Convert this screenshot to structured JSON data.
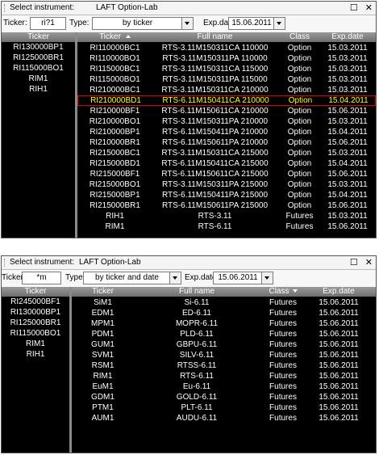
{
  "panel1": {
    "title_label": "Select instrument:",
    "app_name": "LAFT Option-Lab",
    "ticker_label": "Ticker:",
    "ticker_value": "ri?1",
    "type_label": "Type:",
    "type_value": "by ticker",
    "exp_label": "Exp.date:",
    "exp_value": "15.06.2011",
    "left_header": "Ticker",
    "left_items": [
      "RI130000BP1",
      "RI125000BR1",
      "RI115000BO1",
      "RIM1",
      "RIH1"
    ],
    "columns": [
      "Ticker",
      "Full name",
      "Class",
      "Exp.date"
    ],
    "rows": [
      {
        "ticker": "RI110000BC1",
        "full": "RTS-3.11M150311CA 110000",
        "cls": "Option",
        "exp": "15.03.2011"
      },
      {
        "ticker": "RI110000BO1",
        "full": "RTS-3.11M150311PA 110000",
        "cls": "Option",
        "exp": "15.03.2011"
      },
      {
        "ticker": "RI115000BC1",
        "full": "RTS-3.11M150311CA 115000",
        "cls": "Option",
        "exp": "15.03.2011"
      },
      {
        "ticker": "RI115000BO1",
        "full": "RTS-3.11M150311PA 115000",
        "cls": "Option",
        "exp": "15.03.2011"
      },
      {
        "ticker": "RI210000BC1",
        "full": "RTS-3.11M150311CA 210000",
        "cls": "Option",
        "exp": "15.03.2011"
      },
      {
        "ticker": "RI210000BD1",
        "full": "RTS-6.11M150411CA 210000",
        "cls": "Option",
        "exp": "15.04.2011",
        "selected": true
      },
      {
        "ticker": "RI210000BF1",
        "full": "RTS-6.11M150611CA 210000",
        "cls": "Option",
        "exp": "15.06.2011"
      },
      {
        "ticker": "RI210000BO1",
        "full": "RTS-3.11M150311PA 210000",
        "cls": "Option",
        "exp": "15.03.2011"
      },
      {
        "ticker": "RI210000BP1",
        "full": "RTS-6.11M150411PA 210000",
        "cls": "Option",
        "exp": "15.04.2011"
      },
      {
        "ticker": "RI210000BR1",
        "full": "RTS-6.11M150611PA 210000",
        "cls": "Option",
        "exp": "15.06.2011"
      },
      {
        "ticker": "RI215000BC1",
        "full": "RTS-3.11M150311CA 215000",
        "cls": "Option",
        "exp": "15.03.2011"
      },
      {
        "ticker": "RI215000BD1",
        "full": "RTS-6.11M150411CA 215000",
        "cls": "Option",
        "exp": "15.04.2011"
      },
      {
        "ticker": "RI215000BF1",
        "full": "RTS-6.11M150611CA 215000",
        "cls": "Option",
        "exp": "15.06.2011"
      },
      {
        "ticker": "RI215000BO1",
        "full": "RTS-3.11M150311PA 215000",
        "cls": "Option",
        "exp": "15.03.2011"
      },
      {
        "ticker": "RI215000BP1",
        "full": "RTS-6.11M150411PA 215000",
        "cls": "Option",
        "exp": "15.04.2011"
      },
      {
        "ticker": "RI215000BR1",
        "full": "RTS-6.11M150611PA 215000",
        "cls": "Option",
        "exp": "15.06.2011"
      },
      {
        "ticker": "RIH1",
        "full": "RTS-3.11",
        "cls": "Futures",
        "exp": "15.03.2011"
      },
      {
        "ticker": "RIM1",
        "full": "RTS-6.11",
        "cls": "Futures",
        "exp": "15.06.2011"
      }
    ]
  },
  "panel2": {
    "title_label": "Select instrument:",
    "app_name": "LAFT Option-Lab",
    "ticker_label": "Ticker:",
    "ticker_value": "*m",
    "type_label": "Type:",
    "type_value": "by ticker and date",
    "exp_label": "Exp.date:",
    "exp_value": "15.06.2011",
    "left_header": "Ticker",
    "left_items": [
      "RI245000BF1",
      "RI130000BP1",
      "RI125000BR1",
      "RI115000BO1",
      "RIM1",
      "RIH1"
    ],
    "columns": [
      "Ticker",
      "Full name",
      "Class",
      "Exp.date"
    ],
    "rows": [
      {
        "ticker": "SiM1",
        "full": "Si-6.11",
        "cls": "Futures",
        "exp": "15.06.2011"
      },
      {
        "ticker": "EDM1",
        "full": "ED-6.11",
        "cls": "Futures",
        "exp": "15.06.2011"
      },
      {
        "ticker": "MPM1",
        "full": "MOPR-6.11",
        "cls": "Futures",
        "exp": "15.06.2011"
      },
      {
        "ticker": "PDM1",
        "full": "PLD-6.11",
        "cls": "Futures",
        "exp": "15.06.2011"
      },
      {
        "ticker": "GUM1",
        "full": "GBPU-6.11",
        "cls": "Futures",
        "exp": "15.06.2011"
      },
      {
        "ticker": "SVM1",
        "full": "SILV-6.11",
        "cls": "Futures",
        "exp": "15.06.2011"
      },
      {
        "ticker": "RSM1",
        "full": "RTSS-6.11",
        "cls": "Futures",
        "exp": "15.06.2011"
      },
      {
        "ticker": "RIM1",
        "full": "RTS-6.11",
        "cls": "Futures",
        "exp": "15.06.2011"
      },
      {
        "ticker": "EuM1",
        "full": "Eu-6.11",
        "cls": "Futures",
        "exp": "15.06.2011"
      },
      {
        "ticker": "GDM1",
        "full": "GOLD-6.11",
        "cls": "Futures",
        "exp": "15.06.2011"
      },
      {
        "ticker": "PTM1",
        "full": "PLT-6.11",
        "cls": "Futures",
        "exp": "15.06.2011"
      },
      {
        "ticker": "AUM1",
        "full": "AUDU-6.11",
        "cls": "Futures",
        "exp": "15.06.2011"
      }
    ]
  },
  "icons": {
    "restore": "restore-icon",
    "close": "close-icon",
    "dropdown": "chevron-down-icon"
  }
}
